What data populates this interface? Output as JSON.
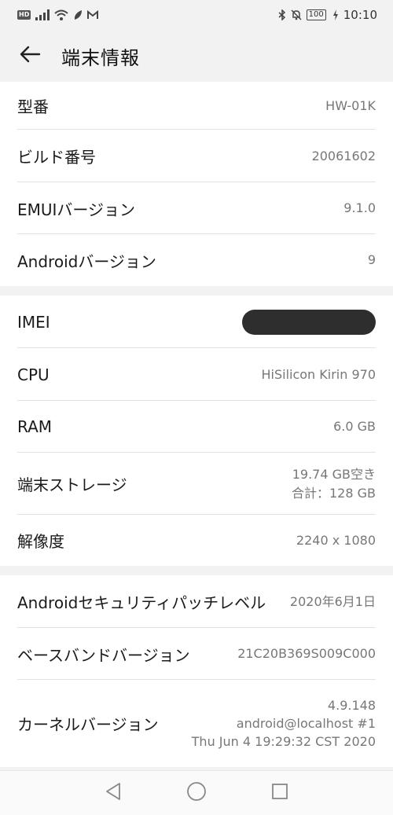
{
  "status_bar": {
    "hd_badge": "HD",
    "battery": "100",
    "time": "10:10",
    "icons": [
      "signal-icon",
      "wifi-icon",
      "leaf-icon",
      "gmail-icon",
      "bluetooth-icon",
      "mute-bell-icon",
      "charging-icon"
    ]
  },
  "header": {
    "back_icon": "arrow-left-icon",
    "title": "端末情報"
  },
  "section1": [
    {
      "label": "型番",
      "value": "HW-01K"
    },
    {
      "label": "ビルド番号",
      "value": "20061602"
    },
    {
      "label": "EMUIバージョン",
      "value": "9.1.0"
    },
    {
      "label": "Androidバージョン",
      "value": "9"
    }
  ],
  "section2": {
    "imei": {
      "label": "IMEI"
    },
    "cpu": {
      "label": "CPU",
      "value": "HiSilicon Kirin 970"
    },
    "ram": {
      "label": "RAM",
      "value": "6.0 GB"
    },
    "storage": {
      "label": "端末ストレージ",
      "value_line1": "19.74  GB空き",
      "value_line2": "合計：128  GB"
    },
    "resolution": {
      "label": "解像度",
      "value": "2240 x 1080"
    }
  },
  "section3": {
    "security_patch": {
      "label": "Androidセキュリティパッチレベル",
      "value": "2020年6月1日"
    },
    "baseband": {
      "label": "ベースバンドバージョン",
      "value": "21C20B369S009C000"
    },
    "kernel": {
      "label": "カーネルバージョン",
      "value_line1": "4.9.148",
      "value_line2": "android@localhost #1",
      "value_line3": "Thu Jun 4 19:29:32 CST 2020"
    }
  },
  "nav_bar": {
    "icons": [
      "back-triangle-icon",
      "home-circle-icon",
      "recents-square-icon"
    ]
  }
}
